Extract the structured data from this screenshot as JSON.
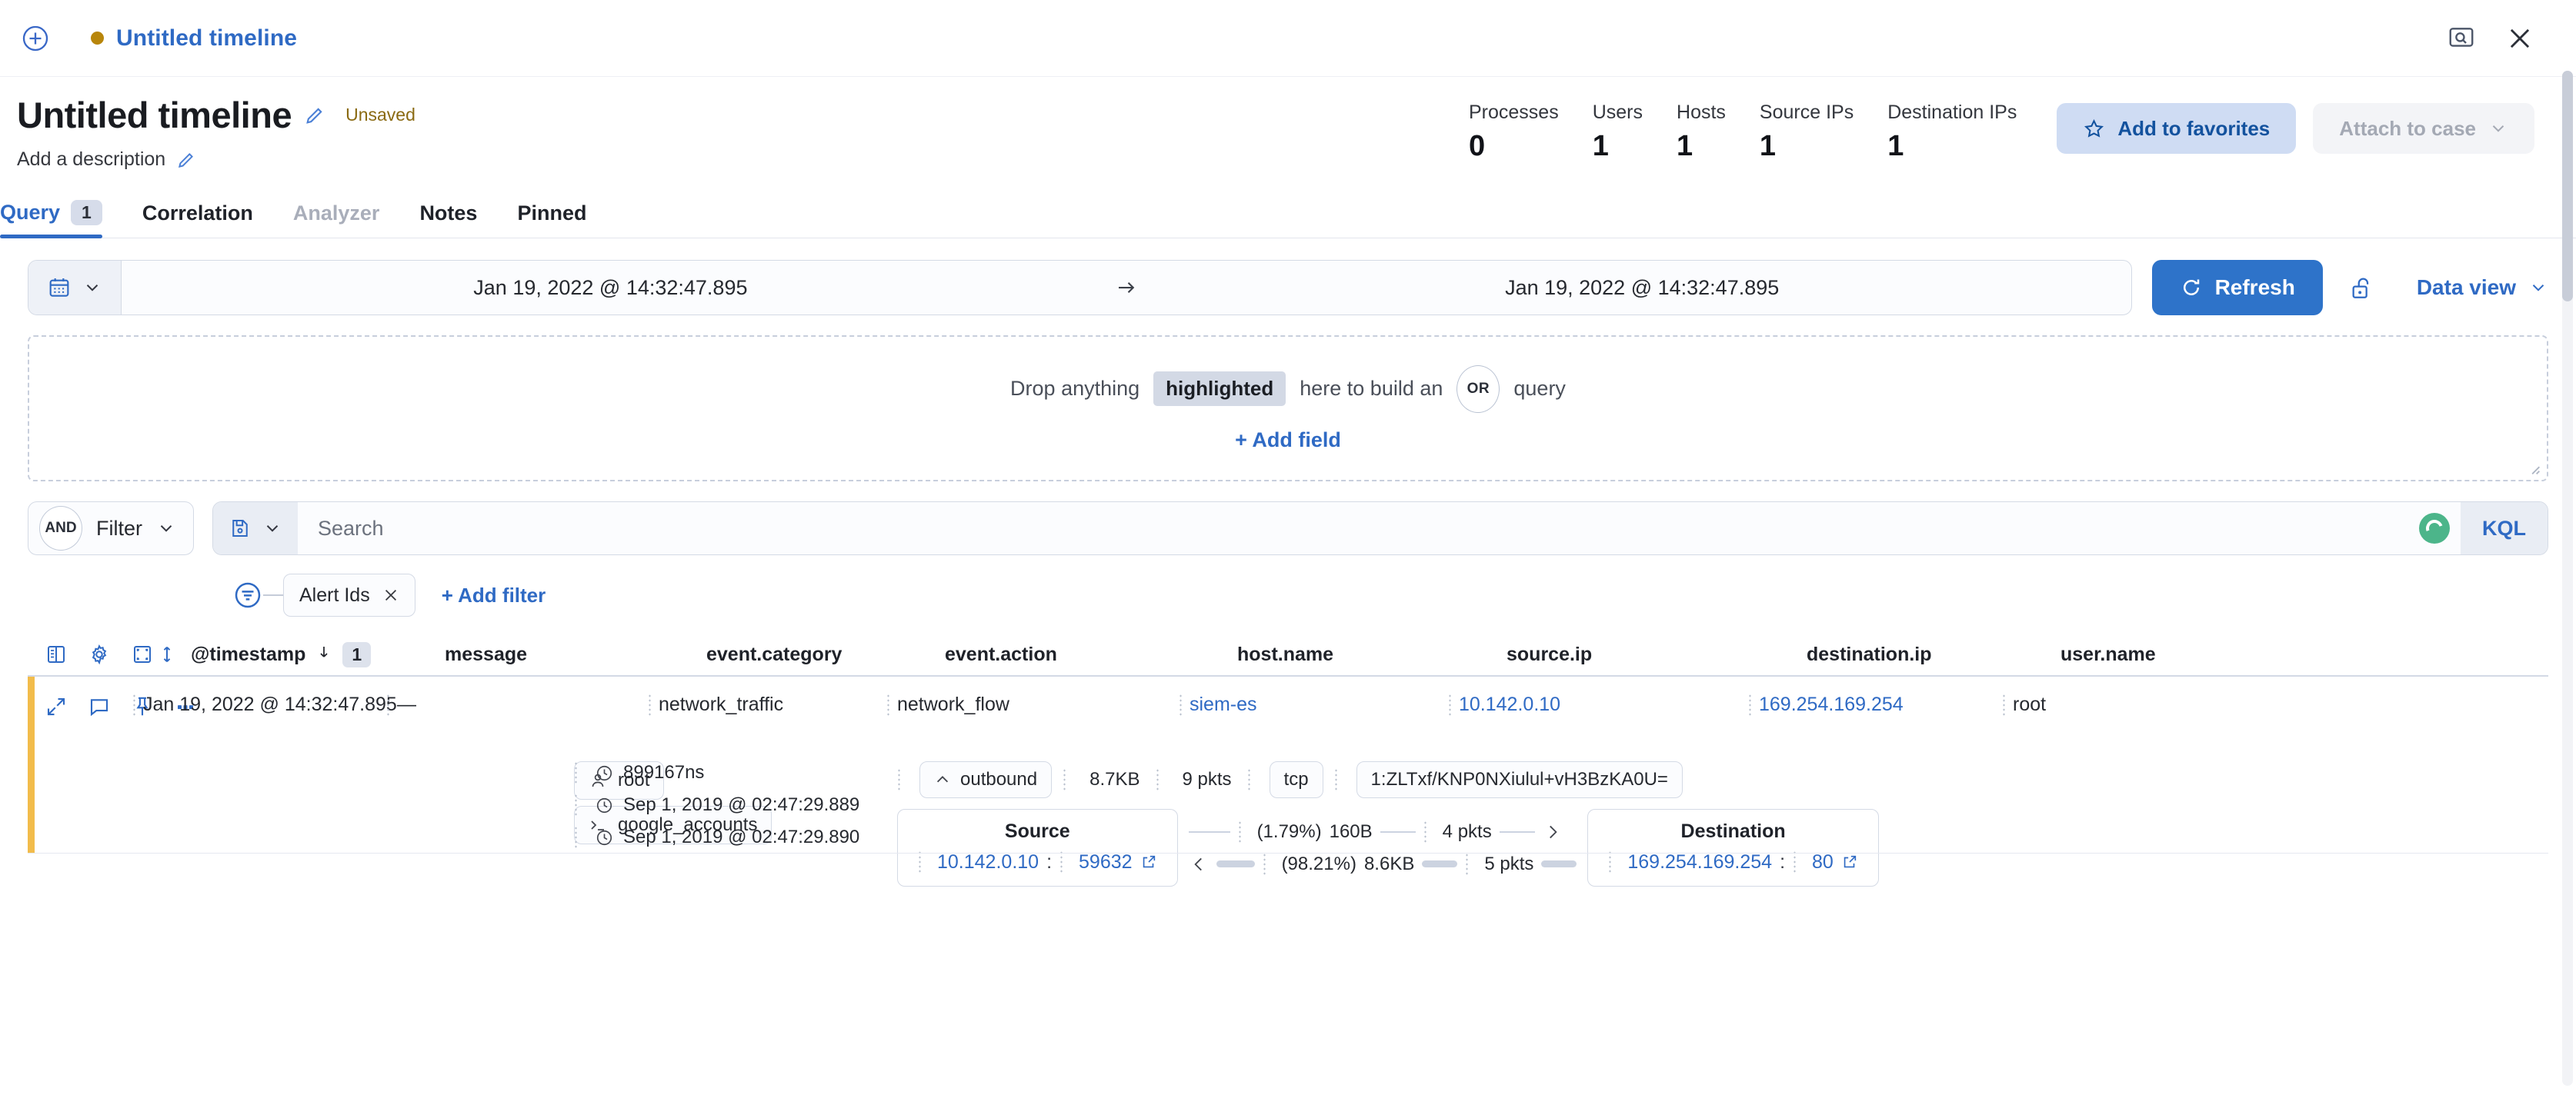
{
  "topbar": {
    "add_icon": "plus-circle-icon",
    "timeline_tab_label": "Untitled timeline",
    "search_icon": "search-page-icon",
    "close_icon": "close-icon"
  },
  "header": {
    "title": "Untitled timeline",
    "edit_icon": "pencil-icon",
    "unsaved_label": "Unsaved",
    "description_placeholder": "Add a description",
    "description_edit_icon": "pencil-icon",
    "stats": [
      {
        "label": "Processes",
        "value": "0"
      },
      {
        "label": "Users",
        "value": "1"
      },
      {
        "label": "Hosts",
        "value": "1"
      },
      {
        "label": "Source IPs",
        "value": "1"
      },
      {
        "label": "Destination IPs",
        "value": "1"
      }
    ],
    "favorites_button": "Add to favorites",
    "favorites_icon": "star-icon",
    "attach_case_button": "Attach to case",
    "attach_case_icon": "chevron-down-icon"
  },
  "tabs": [
    {
      "label": "Query",
      "badge": "1",
      "state": "active"
    },
    {
      "label": "Correlation",
      "badge": "",
      "state": "enabled"
    },
    {
      "label": "Analyzer",
      "badge": "",
      "state": "disabled"
    },
    {
      "label": "Notes",
      "badge": "",
      "state": "enabled"
    },
    {
      "label": "Pinned",
      "badge": "",
      "state": "enabled"
    }
  ],
  "querybar": {
    "calendar_icon": "calendar-icon",
    "start_date": "Jan 19, 2022 @ 14:32:47.895",
    "range_arrow": "→",
    "end_date": "Jan 19, 2022 @ 14:32:47.895",
    "refresh_label": "Refresh",
    "refresh_icon": "refresh-icon",
    "lock_icon": "unlock-icon",
    "data_view_label": "Data view",
    "data_view_icon": "chevron-down-icon"
  },
  "dropzone": {
    "text_before": "Drop anything",
    "highlight_chip": "highlighted",
    "text_middle": "here to build an",
    "operator_badge": "OR",
    "text_after": "query",
    "add_field_label": "+ Add field"
  },
  "filterbar": {
    "operator_badge": "AND",
    "filter_label": "Filter",
    "filter_chevron_icon": "chevron-down-icon",
    "saved_query_icon": "save-icon",
    "saved_query_chevron_icon": "chevron-down-icon",
    "search_placeholder": "Search",
    "loading_icon": "loading-spinner-icon",
    "language_label": "KQL"
  },
  "filterchips": {
    "filter_icon": "filter-circle-icon",
    "chips": [
      {
        "label": "Alert Ids",
        "remove_icon": "close-icon"
      }
    ],
    "add_filter_label": "+ Add filter"
  },
  "table": {
    "toolbar_icons": [
      "columns-icon",
      "gear-icon",
      "fullscreen-icon",
      "sort-updown-icon"
    ],
    "columns": [
      {
        "key": "timestamp",
        "label": "@timestamp",
        "sort_icon": "sort-desc-icon",
        "sort_badge": "1"
      },
      {
        "key": "message",
        "label": "message"
      },
      {
        "key": "event_category",
        "label": "event.category"
      },
      {
        "key": "event_action",
        "label": "event.action"
      },
      {
        "key": "host_name",
        "label": "host.name"
      },
      {
        "key": "source_ip",
        "label": "source.ip"
      },
      {
        "key": "destination_ip",
        "label": "destination.ip"
      },
      {
        "key": "user_name",
        "label": "user.name"
      }
    ],
    "rows": [
      {
        "actions": [
          "expand-icon",
          "comment-icon",
          "pin-icon",
          "more-icon"
        ],
        "timestamp": "Jan 19, 2022 @ 14:32:47.895",
        "message": "—",
        "event_category": "network_traffic",
        "event_action": "network_flow",
        "host_name": "siem-es",
        "source_ip": "10.142.0.10",
        "destination_ip": "169.254.169.254",
        "user_name": "root"
      }
    ],
    "detail": {
      "entity_chips": [
        {
          "label": "root",
          "icon": "user-icon"
        },
        {
          "label": "google_accounts",
          "icon": "terminal-icon"
        }
      ],
      "timestamps": [
        {
          "icon": "clock-icon",
          "value": "899167ns"
        },
        {
          "icon": "clock-icon",
          "value": "Sep 1, 2019 @ 02:47:29.889"
        },
        {
          "icon": "clock-icon",
          "value": "Sep 1, 2019 @ 02:47:29.890"
        }
      ],
      "flow_meta": {
        "direction": "outbound",
        "direction_icon": "caret-up-icon",
        "bytes": "8.7KB",
        "packets": "9 pkts",
        "protocol": "tcp",
        "community_id": "1:ZLTxf/KNP0NXiulul+vH3BzKA0U="
      },
      "source": {
        "title": "Source",
        "ip": "10.142.0.10",
        "separator": ":",
        "port": "59632",
        "external_icon": "external-link-icon"
      },
      "destination": {
        "title": "Destination",
        "ip": "169.254.169.254",
        "separator": ":",
        "port": "80",
        "external_icon": "external-link-icon"
      },
      "flow_stats": [
        {
          "percent": "(1.79%)",
          "bytes": "160B",
          "packets": "4 pkts",
          "direction": "outbound"
        },
        {
          "percent": "(98.21%)",
          "bytes": "8.6KB",
          "packets": "5 pkts",
          "direction": "inbound"
        }
      ]
    }
  },
  "colors": {
    "accent_blue": "#2f6ac4",
    "row_accent": "#f2bc4b",
    "unsaved_amber": "#8a6a12",
    "spinner_green": "#4cb58a"
  }
}
